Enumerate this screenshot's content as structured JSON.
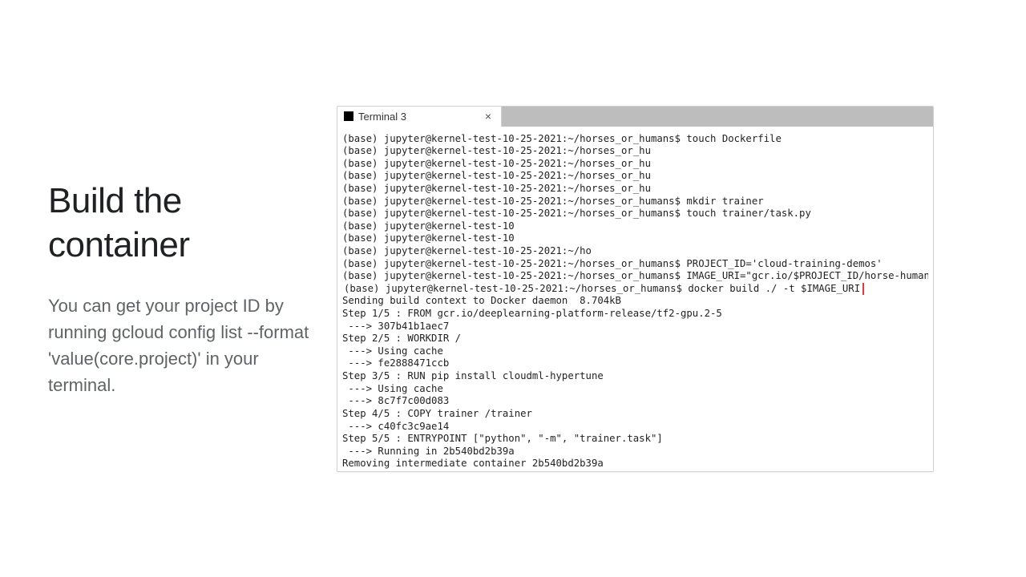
{
  "heading": "Build the container",
  "subtext": "You can get your project ID by running gcloud config list --format 'value(core.project)' in your terminal.",
  "terminal": {
    "tab_title": "Terminal 3",
    "tab_close": "×",
    "lines": [
      "(base) jupyter@kernel-test-10-25-2021:~/horses_or_humans$ touch Dockerfile",
      "(base) jupyter@kernel-test-10-25-2021:~/horses_or_hu",
      "(base) jupyter@kernel-test-10-25-2021:~/horses_or_hu",
      "(base) jupyter@kernel-test-10-25-2021:~/horses_or_hu",
      "(base) jupyter@kernel-test-10-25-2021:~/horses_or_hu",
      "(base) jupyter@kernel-test-10-25-2021:~/horses_or_humans$ mkdir trainer",
      "(base) jupyter@kernel-test-10-25-2021:~/horses_or_humans$ touch trainer/task.py",
      "(base) jupyter@kernel-test-10",
      "(base) jupyter@kernel-test-10",
      "(base) jupyter@kernel-test-10-25-2021:~/ho",
      "(base) jupyter@kernel-test-10-25-2021:~/horses_or_humans$ PROJECT_ID='cloud-training-demos'",
      "(base) jupyter@kernel-test-10-25-2021:~/horses_or_humans$ IMAGE_URI=\"gcr.io/$PROJECT_ID/horse-human:hypertu",
      "(base) jupyter@kernel-test-10-25-2021:~/horses_or_humans$ docker build ./ -t $IMAGE_URI",
      "Sending build context to Docker daemon  8.704kB",
      "Step 1/5 : FROM gcr.io/deeplearning-platform-release/tf2-gpu.2-5",
      " ---> 307b41b1aec7",
      "Step 2/5 : WORKDIR /",
      " ---> Using cache",
      " ---> fe2888471ccb",
      "Step 3/5 : RUN pip install cloudml-hypertune",
      " ---> Using cache",
      " ---> 8c7f7c00d083",
      "Step 4/5 : COPY trainer /trainer",
      " ---> c40fc3c9ae14",
      "Step 5/5 : ENTRYPOINT [\"python\", \"-m\", \"trainer.task\"]",
      " ---> Running in 2b540bd2b39a",
      "Removing intermediate container 2b540bd2b39a"
    ],
    "highlight_index": 12
  }
}
